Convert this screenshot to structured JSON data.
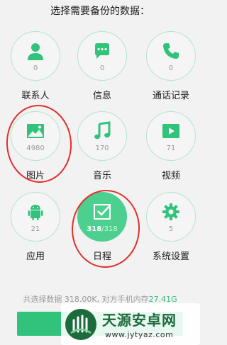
{
  "header": {
    "title": "选择需要备份的数据："
  },
  "items": [
    {
      "label": "联系人",
      "count": "0",
      "icon": "contact-icon"
    },
    {
      "label": "信息",
      "count": "0",
      "icon": "message-icon"
    },
    {
      "label": "通话记录",
      "count": "0",
      "icon": "phone-icon"
    },
    {
      "label": "图片",
      "count": "4980",
      "icon": "image-icon"
    },
    {
      "label": "音乐",
      "count": "170",
      "icon": "music-icon"
    },
    {
      "label": "视频",
      "count": "71",
      "icon": "video-icon"
    },
    {
      "label": "应用",
      "count": "21",
      "icon": "android-icon"
    },
    {
      "label": "日程",
      "count": "318",
      "total": "/318",
      "icon": "calendar-check-icon",
      "selected": true
    },
    {
      "label": "系统设置",
      "count": "5",
      "icon": "gear-icon"
    }
  ],
  "footer": {
    "summary_prefix": "共选择数据 318.00K, 对方手机内存",
    "free_space": "27.41G"
  },
  "watermark": {
    "title": "天源安卓网",
    "url": "www.jytyaz.com"
  },
  "colors": {
    "accent": "#31c27c",
    "annotation": "#e0302a"
  }
}
